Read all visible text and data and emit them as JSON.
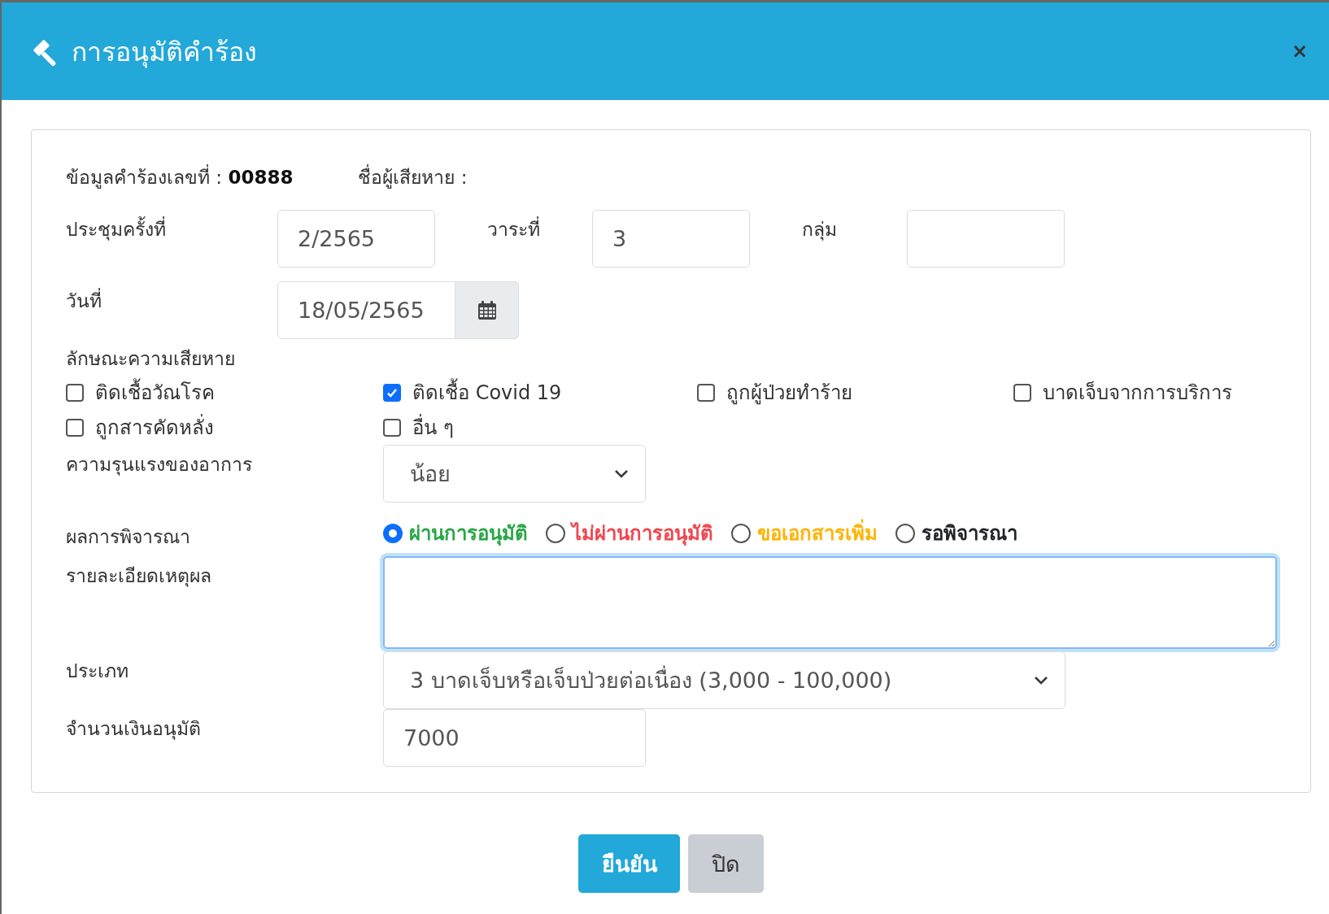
{
  "dialog": {
    "title": "การอนุมัติคำร้อง",
    "close": "×"
  },
  "info": {
    "request_label": "ข้อมูลคำร้องเลขที่ :",
    "request_no": "00888",
    "victim_label": "ชื่อผู้เสียหาย :"
  },
  "meeting": {
    "label": "ประชุมครั้งที่",
    "value": "2/2565",
    "agenda_label": "วาระที่",
    "agenda_value": "3",
    "group_label": "กลุ่ม"
  },
  "date": {
    "label": "วันที่",
    "value": "18/05/2565"
  },
  "damage": {
    "label": "ลักษณะความเสียหาย",
    "options": [
      {
        "label": "ติดเชื้อวัณโรค",
        "checked": false
      },
      {
        "label": "ติดเชื้อ Covid 19",
        "checked": true
      },
      {
        "label": "ถูกผู้ป่วยทำร้าย",
        "checked": false
      },
      {
        "label": "บาดเจ็บจากการบริการ",
        "checked": false
      },
      {
        "label": "ถูกสารคัดหลั่ง",
        "checked": false
      },
      {
        "label": "อื่น ๆ",
        "checked": false
      }
    ]
  },
  "severity": {
    "label": "ความรุนแรงของอาการ",
    "value": "น้อย"
  },
  "result": {
    "label": "ผลการพิจารณา",
    "options": [
      {
        "label": "ผ่านการอนุมัติ",
        "selected": true,
        "color": "#28a745"
      },
      {
        "label": "ไม่ผ่านการอนุมัติ",
        "selected": false,
        "color": "#f0464f"
      },
      {
        "label": "ขอเอกสารเพิ่ม",
        "selected": false,
        "color": "#ffb300"
      },
      {
        "label": "รอพิจารณา",
        "selected": false,
        "color": "#212529"
      }
    ]
  },
  "reason": {
    "label": "รายละเอียดเหตุผล"
  },
  "type": {
    "label": "ประเภท",
    "value": "3 บาดเจ็บหรือเจ็บป่วยต่อเนื่อง (3,000 - 100,000)"
  },
  "amount": {
    "label": "จำนวนเงินอนุมัติ",
    "value": "7000"
  },
  "buttons": [
    {
      "label": "ยืนยัน",
      "kind": "primary"
    },
    {
      "label": "ปิด",
      "kind": "secondary"
    }
  ]
}
